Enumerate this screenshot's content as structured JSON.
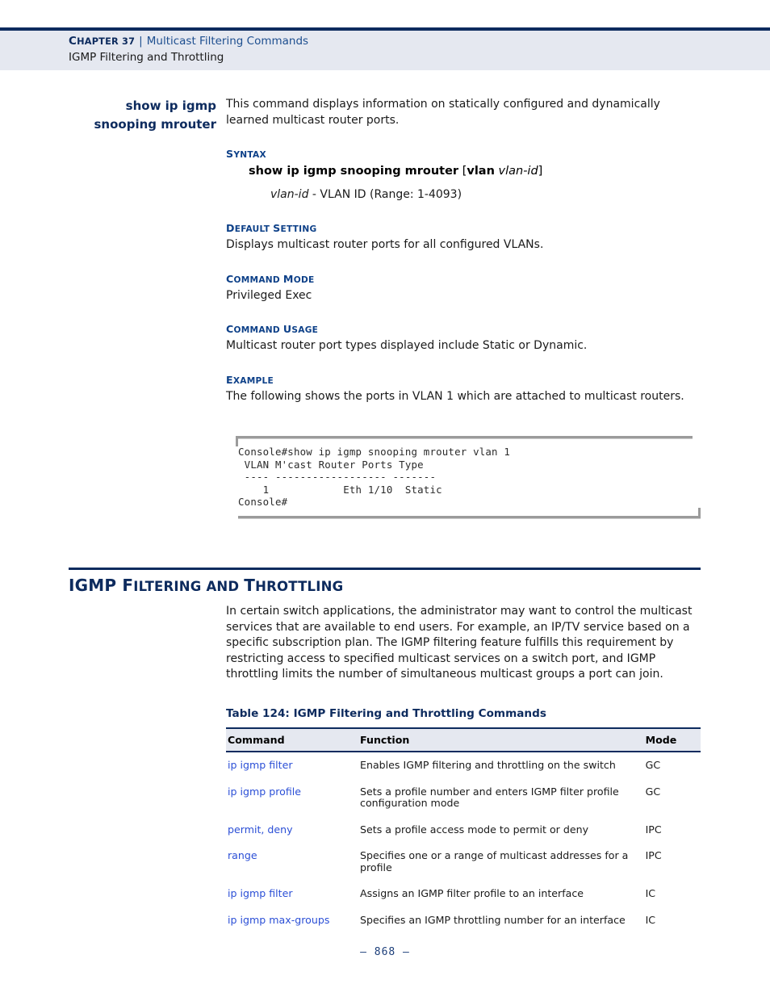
{
  "header": {
    "chapter_label": "Chapter 37",
    "chapter_small": "HAPTER 37",
    "chapter_cap": "C",
    "separator": "|",
    "topic": "Multicast Filtering Commands",
    "subtopic": "IGMP Filtering and Throttling"
  },
  "command": {
    "title_line1": "show ip igmp",
    "title_line2": "snooping mrouter",
    "description": "This command displays information on statically configured and dynamically learned multicast router ports.",
    "syntax": {
      "heading_cap": "S",
      "heading_rest": "YNTAX",
      "command_bold": "show ip igmp snooping mrouter",
      "bracket_open": "[",
      "keyword": "vlan",
      "param": "vlan-id",
      "bracket_close": "]",
      "param_desc_italic": "vlan-id",
      "param_desc_rest": " - VLAN ID (Range: 1-4093)"
    },
    "default_setting": {
      "heading_cap_d": "D",
      "heading_mid": "EFAULT ",
      "heading_cap_s": "S",
      "heading_end": "ETTING",
      "text": "Displays multicast router ports for all configured VLANs."
    },
    "command_mode": {
      "heading_cap_c": "C",
      "heading_mid": "OMMAND ",
      "heading_cap_m": "M",
      "heading_end": "ODE",
      "text": "Privileged Exec"
    },
    "command_usage": {
      "heading_cap_c": "C",
      "heading_mid": "OMMAND ",
      "heading_cap_u": "U",
      "heading_end": "SAGE",
      "text": "Multicast router port types displayed include Static or Dynamic."
    },
    "example": {
      "heading_cap": "E",
      "heading_rest": "XAMPLE",
      "text": "The following shows the ports in VLAN 1 which are attached to multicast routers.",
      "console_output": "Console#show ip igmp snooping mrouter vlan 1\n VLAN M'cast Router Ports Type\n ---- ------------------ -------\n    1            Eth 1/10  Static\nConsole#"
    }
  },
  "section": {
    "heading_igmp": "IGMP ",
    "heading_f": "F",
    "heading_iltering": "ILTERING AND ",
    "heading_t": "T",
    "heading_hrottling": "HROTTLING",
    "heading_plain": "IGMP Filtering and Throttling",
    "body": "In certain switch applications, the administrator may want to control the multicast services that are available to end users. For example, an IP/TV service based on a specific subscription plan. The IGMP filtering feature fulfills this requirement by restricting access to specified multicast services on a switch port, and IGMP throttling limits the number of simultaneous multicast groups a port can join."
  },
  "table": {
    "caption": "Table 124: IGMP Filtering and Throttling Commands",
    "columns": [
      "Command",
      "Function",
      "Mode"
    ],
    "rows": [
      {
        "command": "ip igmp filter",
        "function": "Enables IGMP filtering and throttling on the switch",
        "mode": "GC"
      },
      {
        "command": "ip igmp profile",
        "function": "Sets a profile number and enters IGMP filter profile configuration mode",
        "mode": "GC"
      },
      {
        "command": "permit, deny",
        "function": "Sets a profile access mode to permit or deny",
        "mode": "IPC"
      },
      {
        "command": "range",
        "function": "Specifies one or a range of multicast addresses for a profile",
        "mode": "IPC"
      },
      {
        "command": "ip igmp filter",
        "function": "Assigns an IGMP filter profile to an interface",
        "mode": "IC"
      },
      {
        "command": "ip igmp max-groups",
        "function": "Specifies an IGMP throttling number for an interface",
        "mode": "IC"
      }
    ]
  },
  "footer": {
    "page_number": "–  868  –"
  },
  "colors": {
    "navy": "#0d2b5e",
    "heading_blue": "#0d4088",
    "link_blue": "#2b4fd6",
    "band": "#e5e8f0"
  }
}
